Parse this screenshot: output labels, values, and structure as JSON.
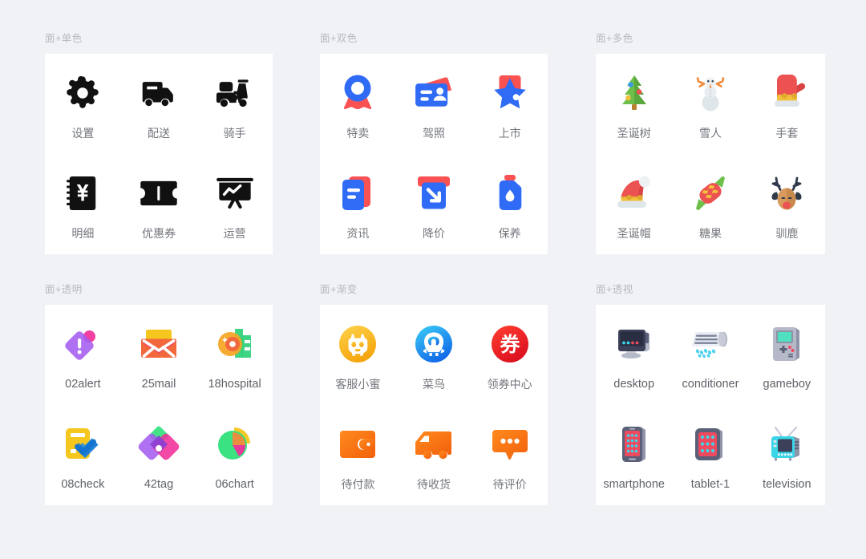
{
  "page": {
    "background_color": "#f0f2f5",
    "card_color": "#ffffff",
    "label_color": "#73767c",
    "title_color": "#b6b9c0"
  },
  "panels": [
    {
      "id": "mono",
      "title": "面+单色",
      "style": "monochrome",
      "accent": "#111111",
      "items": [
        {
          "label": "设置",
          "icon": "gear-icon"
        },
        {
          "label": "配送",
          "icon": "delivery-truck-icon"
        },
        {
          "label": "骑手",
          "icon": "scooter-rider-icon"
        },
        {
          "label": "明细",
          "icon": "yuan-ledger-icon"
        },
        {
          "label": "优惠券",
          "icon": "coupon-ticket-icon"
        },
        {
          "label": "运营",
          "icon": "presentation-chart-icon"
        }
      ]
    },
    {
      "id": "duotone",
      "title": "面+双色",
      "style": "duotone",
      "accent": "#2f6bf5",
      "accent2": "#fa5252",
      "items": [
        {
          "label": "特卖",
          "icon": "sale-badge-icon"
        },
        {
          "label": "驾照",
          "icon": "drivers-license-icon"
        },
        {
          "label": "上市",
          "icon": "star-launch-icon"
        },
        {
          "label": "资讯",
          "icon": "news-document-icon"
        },
        {
          "label": "降价",
          "icon": "price-drop-arrow-icon"
        },
        {
          "label": "保养",
          "icon": "oil-bottle-icon"
        }
      ]
    },
    {
      "id": "multicolor",
      "title": "面+多色",
      "style": "multicolor",
      "items": [
        {
          "label": "圣诞树",
          "icon": "christmas-tree-icon"
        },
        {
          "label": "雪人",
          "icon": "snowman-icon"
        },
        {
          "label": "手套",
          "icon": "mitten-icon"
        },
        {
          "label": "圣诞帽",
          "icon": "santa-hat-icon"
        },
        {
          "label": "糖果",
          "icon": "candy-icon"
        },
        {
          "label": "驯鹿",
          "icon": "reindeer-icon"
        }
      ]
    },
    {
      "id": "transparent",
      "title": "面+透明",
      "style": "transparent",
      "items": [
        {
          "label": "02alert",
          "icon": "alert-diamond-icon",
          "latin": true
        },
        {
          "label": "25mail",
          "icon": "mail-envelope-icon",
          "latin": true
        },
        {
          "label": "18hospital",
          "icon": "hospital-coin-icon",
          "latin": true
        },
        {
          "label": "08check",
          "icon": "check-clipboard-icon",
          "latin": true
        },
        {
          "label": "42tag",
          "icon": "tag-diamond-icon",
          "latin": true
        },
        {
          "label": "06chart",
          "icon": "pie-chart-icon",
          "latin": true
        }
      ]
    },
    {
      "id": "gradient",
      "title": "面+渐变",
      "style": "gradient",
      "items": [
        {
          "label": "客服小蜜",
          "icon": "customer-service-bee-icon"
        },
        {
          "label": "菜鸟",
          "icon": "cainiao-bird-icon"
        },
        {
          "label": "领券中心",
          "icon": "coupon-center-icon"
        },
        {
          "label": "待付款",
          "icon": "wallet-icon"
        },
        {
          "label": "待收货",
          "icon": "truck-gradient-icon"
        },
        {
          "label": "待评价",
          "icon": "comment-bubble-icon"
        }
      ]
    },
    {
      "id": "perspective",
      "title": "面+透视",
      "style": "perspective",
      "items": [
        {
          "label": "desktop",
          "icon": "desktop-computer-icon",
          "latin": true
        },
        {
          "label": "conditioner",
          "icon": "air-conditioner-icon",
          "latin": true
        },
        {
          "label": "gameboy",
          "icon": "handheld-console-icon",
          "latin": true
        },
        {
          "label": "smartphone",
          "icon": "smartphone-icon",
          "latin": true
        },
        {
          "label": "tablet-1",
          "icon": "tablet-icon",
          "latin": true
        },
        {
          "label": "television",
          "icon": "television-icon",
          "latin": true
        }
      ]
    }
  ]
}
